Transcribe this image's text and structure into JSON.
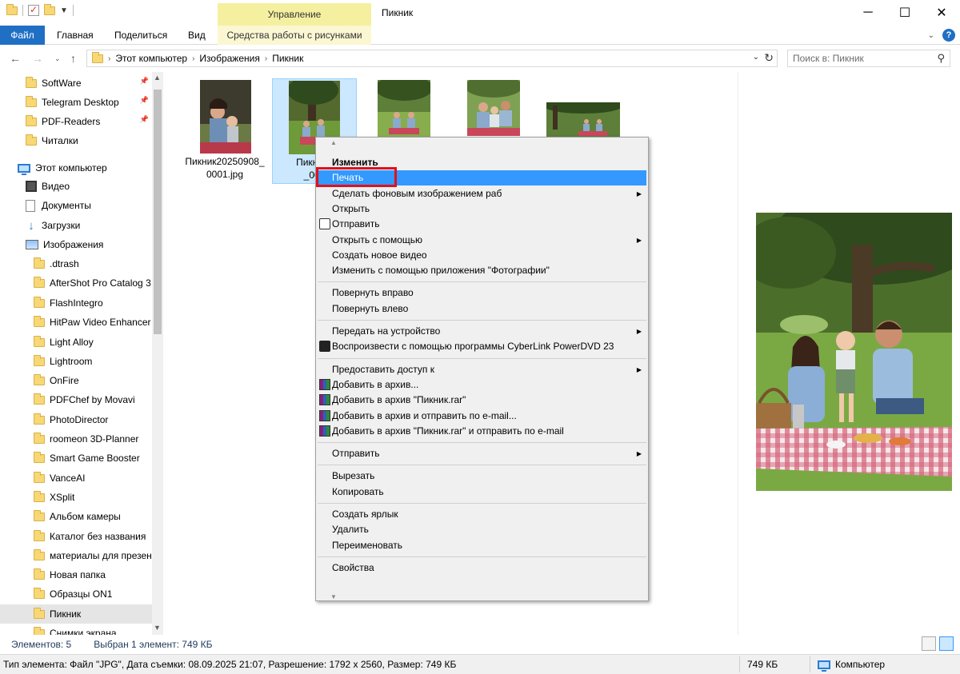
{
  "window": {
    "title": "Пикник",
    "controls": {
      "minimize": "─",
      "maximize": "☐",
      "close": "✕"
    }
  },
  "ribbon": {
    "manage_tab_label": "Управление",
    "tabs": [
      "Файл",
      "Главная",
      "Поделиться",
      "Вид",
      "Средства работы с рисунками"
    ],
    "help_label": "?"
  },
  "address": {
    "crumbs": [
      "Этот компьютер",
      "Изображения",
      "Пикник"
    ],
    "search_placeholder": "Поиск в: Пикник"
  },
  "sidebar": {
    "items": [
      {
        "label": "SoftWare",
        "type": "folder",
        "pinned": true
      },
      {
        "label": "Telegram Desktop",
        "type": "folder",
        "pinned": true
      },
      {
        "label": "PDF-Readers",
        "type": "folder",
        "pinned": true
      },
      {
        "label": "Читалки",
        "type": "folder",
        "pinned": false
      },
      {
        "label": "Этот компьютер",
        "type": "pc"
      },
      {
        "label": "Видео",
        "type": "video"
      },
      {
        "label": "Документы",
        "type": "docs"
      },
      {
        "label": "Загрузки",
        "type": "downloads"
      },
      {
        "label": "Изображения",
        "type": "images"
      },
      {
        "label": ".dtrash",
        "type": "folder"
      },
      {
        "label": "AfterShot Pro Catalog 3",
        "type": "folder"
      },
      {
        "label": "FlashIntegro",
        "type": "folder"
      },
      {
        "label": "HitPaw Video Enhancer",
        "type": "folder"
      },
      {
        "label": "Light Alloy",
        "type": "folder"
      },
      {
        "label": "Lightroom",
        "type": "folder"
      },
      {
        "label": "OnFire",
        "type": "folder"
      },
      {
        "label": "PDFChef by Movavi",
        "type": "folder"
      },
      {
        "label": "PhotoDirector",
        "type": "folder"
      },
      {
        "label": "roomeon 3D-Planner",
        "type": "folder"
      },
      {
        "label": "Smart Game Booster",
        "type": "folder"
      },
      {
        "label": "VanceAI",
        "type": "folder"
      },
      {
        "label": "XSplit",
        "type": "folder"
      },
      {
        "label": "Альбом камеры",
        "type": "folder"
      },
      {
        "label": "Каталог без названия",
        "type": "folder"
      },
      {
        "label": "материалы для презен",
        "type": "folder"
      },
      {
        "label": "Новая папка",
        "type": "folder"
      },
      {
        "label": "Образцы ON1",
        "type": "folder"
      },
      {
        "label": "Пикник",
        "type": "folder",
        "selected": true
      },
      {
        "label": "Снимки экрана",
        "type": "folder"
      }
    ]
  },
  "files": [
    {
      "name": "Пикник20250908_0001.jpg",
      "selected": false
    },
    {
      "name": "Пикник20250908_0002.jpg",
      "selected": true
    },
    {
      "name": "",
      "selected": false
    },
    {
      "name": "",
      "selected": false
    },
    {
      "name": "",
      "selected": false
    }
  ],
  "selected_file_label": "Пикник2",
  "selected_file_label2": "_000",
  "context_menu": {
    "items": [
      {
        "label": "Изменить",
        "bold": true
      },
      {
        "label": "Печать",
        "highlighted": true
      },
      {
        "label": "Сделать фоновым изображением раб",
        "submenu": true
      },
      {
        "label": "Открыть"
      },
      {
        "label": "Отправить",
        "icon": "share-icon"
      },
      {
        "label": "Открыть с помощью",
        "submenu": true
      },
      {
        "label": "Создать новое видео"
      },
      {
        "label": "Изменить с помощью приложения \"Фотографии\""
      },
      {
        "separator": true
      },
      {
        "label": "Повернуть вправо"
      },
      {
        "label": "Повернуть влево"
      },
      {
        "separator": true
      },
      {
        "label": "Передать на устройство",
        "submenu": true
      },
      {
        "label": "Воспроизвести с помощью программы CyberLink PowerDVD 23",
        "icon": "powerdvd-icon"
      },
      {
        "separator": true
      },
      {
        "label": "Предоставить доступ к",
        "submenu": true
      },
      {
        "label": "Добавить в архив...",
        "icon": "winrar-icon"
      },
      {
        "label": "Добавить в архив \"Пикник.rar\"",
        "icon": "winrar-icon"
      },
      {
        "label": "Добавить в архив и отправить по e-mail...",
        "icon": "winrar-icon"
      },
      {
        "label": "Добавить в архив \"Пикник.rar\" и отправить по e-mail",
        "icon": "winrar-icon"
      },
      {
        "separator": true
      },
      {
        "label": "Отправить",
        "submenu": true
      },
      {
        "separator": true
      },
      {
        "label": "Вырезать"
      },
      {
        "label": "Копировать"
      },
      {
        "separator": true
      },
      {
        "label": "Создать ярлык"
      },
      {
        "label": "Удалить"
      },
      {
        "label": "Переименовать"
      },
      {
        "separator": true
      },
      {
        "label": "Свойства"
      }
    ]
  },
  "status": {
    "count": "Элементов: 5",
    "selected": "Выбран 1 элемент: 749 КБ"
  },
  "details": {
    "info": "Тип элемента: Файл \"JPG\", Дата съемки: 08.09.2025 21:07, Разрешение: 1792 x 2560, Размер: 749 КБ",
    "size": "749 КБ",
    "location": "Компьютер"
  },
  "colors": {
    "accent": "#1f6fc5",
    "selection": "#cce8ff",
    "menu_highlight": "#3399ff",
    "annotation_red": "#e0101e",
    "manage_tab": "#f5f0a0"
  }
}
